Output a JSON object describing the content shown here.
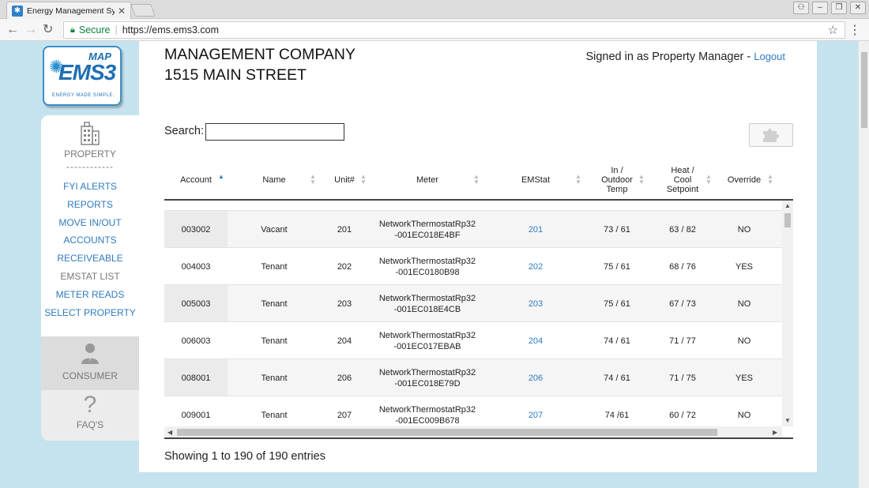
{
  "browser": {
    "tab_title": "Energy Management Syste",
    "secure_label": "Secure",
    "url": "https://ems.ems3.com"
  },
  "logo": {
    "map": "MAP",
    "ems": "EMS3",
    "tagline": "ENERGY MADE SIMPLE."
  },
  "header": {
    "company": "MANAGEMENT COMPANY",
    "address": "1515 MAIN STREET",
    "signed_in": "Signed in as Property Manager -",
    "logout": "Logout"
  },
  "sidebar": {
    "property_label": "PROPERTY",
    "dashes": "------------",
    "items": [
      {
        "label": "FYI ALERTS",
        "active": true
      },
      {
        "label": "REPORTS",
        "active": true
      },
      {
        "label": "MOVE IN/OUT",
        "active": true
      },
      {
        "label": "ACCOUNTS",
        "active": true
      },
      {
        "label": "RECEIVEABLE",
        "active": true
      },
      {
        "label": "EMSTAT LIST",
        "active": false
      },
      {
        "label": "METER READS",
        "active": true
      },
      {
        "label": "SELECT PROPERTY",
        "active": true
      }
    ],
    "consumer_label": "CONSUMER",
    "faq_label": "FAQ'S"
  },
  "search": {
    "label": "Search:",
    "value": ""
  },
  "table": {
    "columns": [
      "Account",
      "Name",
      "Unit#",
      "Meter",
      "EMStat",
      "In / Outdoor Temp",
      "Heat / Cool Setpoint",
      "Override"
    ],
    "rows": [
      {
        "account": "003002",
        "name": "Vacant",
        "unit": "201",
        "meter1": "NetworkThermostatRp32",
        "meter2": "-001EC018E4BF",
        "emstat": "201",
        "temp": "73 /  61",
        "setpoint": "63 / 82",
        "override": "NO"
      },
      {
        "account": "004003",
        "name": "Tenant",
        "unit": "202",
        "meter1": "NetworkThermostatRp32",
        "meter2": "-001EC0180B98",
        "emstat": "202",
        "temp": "75 / 61",
        "setpoint": "68 / 76",
        "override": "YES"
      },
      {
        "account": "005003",
        "name": "Tenant",
        "unit": "203",
        "meter1": "NetworkThermostatRp32",
        "meter2": "-001EC018E4CB",
        "emstat": "203",
        "temp": "75 / 61",
        "setpoint": "67 / 73",
        "override": "NO"
      },
      {
        "account": "006003",
        "name": "Tenant",
        "unit": "204",
        "meter1": "NetworkThermostatRp32",
        "meter2": "-001EC017EBAB",
        "emstat": "204",
        "temp": "74 / 61",
        "setpoint": "71 / 77",
        "override": "NO"
      },
      {
        "account": "008001",
        "name": "Tenant",
        "unit": "206",
        "meter1": "NetworkThermostatRp32",
        "meter2": "-001EC018E79D",
        "emstat": "206",
        "temp": "74 / 61",
        "setpoint": "71 / 75",
        "override": "YES"
      },
      {
        "account": "009001",
        "name": "Tenant",
        "unit": "207",
        "meter1": "NetworkThermostatRp32",
        "meter2": "-001EC009B678",
        "emstat": "207",
        "temp": "74 /61",
        "setpoint": "60 / 72",
        "override": "NO"
      }
    ]
  },
  "footer": {
    "showing": "Showing 1 to 190 of 190 entries"
  }
}
